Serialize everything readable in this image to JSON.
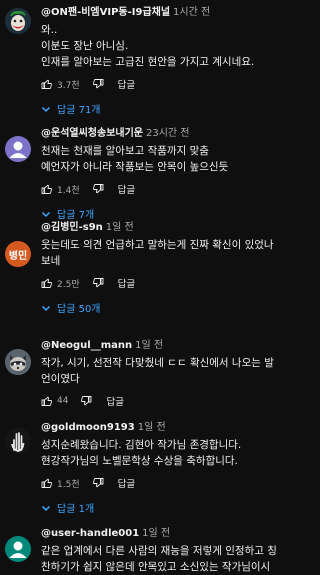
{
  "comments": [
    {
      "handle": "@ON팬-비엠VIP동-I9급채널",
      "time": "1시간 전",
      "lines": [
        "와..",
        "이분도 장난 아니심.",
        "인재를 알아보는 고급진 현안을 가지고 계시네요."
      ],
      "likes": "3.7천",
      "reply_label": "답글",
      "replies_label": "답글 71개"
    },
    {
      "handle": "@운석열씨청송보내기운",
      "time": "23시간 전",
      "lines": [
        "천재는 천재를 알아보고 작품까지 맞춤",
        "예언자가 아니라 작품보는 안목이 높으신듯"
      ],
      "likes": "1.4천",
      "reply_label": "답글",
      "replies_label": "답글 7개"
    },
    {
      "handle": "@김병민-s9n",
      "time": "1일 전",
      "avatar_text": "병민",
      "lines": [
        "웃는데도 의견 언급하고 말하는게 진짜 확신이 있었나",
        "보네"
      ],
      "likes": "2.5만",
      "reply_label": "답글",
      "replies_label": "답글 50개"
    },
    {
      "handle": "@Neogul__mann",
      "time": "1일 전",
      "lines": [
        "작가, 시기, 선전작 다맞췄네 ㄷㄷ 확신에서 나오는 발",
        "언이였다"
      ],
      "likes": "44",
      "reply_label": "답글",
      "replies_label": ""
    },
    {
      "handle": "@goldmoon9193",
      "time": "1일 전",
      "lines": [
        "성지순례왔습니다. 김현아 작가님 존경합니다.",
        "현강작가님의 노벨문학상 수상을 축하합니다."
      ],
      "likes": "1.5천",
      "reply_label": "답글",
      "replies_label": "답글 1개"
    },
    {
      "handle": "@user-handle001",
      "time": "1일 전",
      "lines": [
        "같은 업계에서 다른 사람의 재능을 저렇게 인정하고 칭",
        "찬하기가 쉽지 않은데 안목있고 소신있는 작가님이시"
      ],
      "likes": "",
      "reply_label": "",
      "replies_label": ""
    }
  ],
  "colors": {
    "background": "#0f0f0f",
    "text": "#f1f1f1",
    "muted": "#aaaaaa",
    "link": "#3ea6ff"
  }
}
